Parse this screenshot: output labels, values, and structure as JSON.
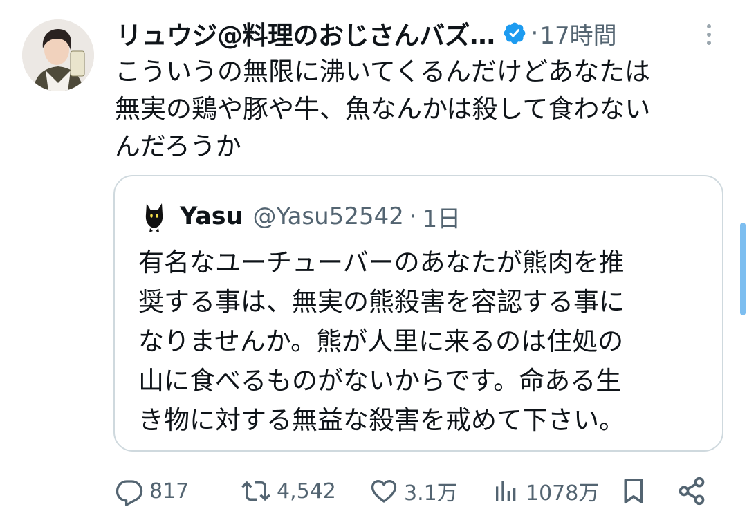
{
  "tweet": {
    "author_name": "リュウジ@料理のおじさんバズ…",
    "verified_icon": "verified-badge-icon",
    "separator": "·",
    "time": "17時間",
    "text": "こういうの無限に沸いてくるんだけどあなたは\n無実の鶏や豚や牛、魚なんかは殺して食わない\nんだろうか"
  },
  "quote": {
    "name": "Yasu",
    "handle": "@Yasu52542",
    "separator": "·",
    "time": "1日",
    "text": "有名なユーチューバーのあなたが熊肉を推\n奨する事は、無実の熊殺害を容認する事に\nなりませんか。熊が人里に来るのは住処の\n山に食べるものがないからです。命ある生\nき物に対する無益な殺害を戒めて下さい。"
  },
  "actions": {
    "replies": "817",
    "retweets": "4,542",
    "likes": "3.1万",
    "views": "1078万"
  },
  "colors": {
    "text": "#0f1419",
    "muted": "#536471",
    "verified": "#1d9bf0",
    "border": "#cfd9de"
  }
}
